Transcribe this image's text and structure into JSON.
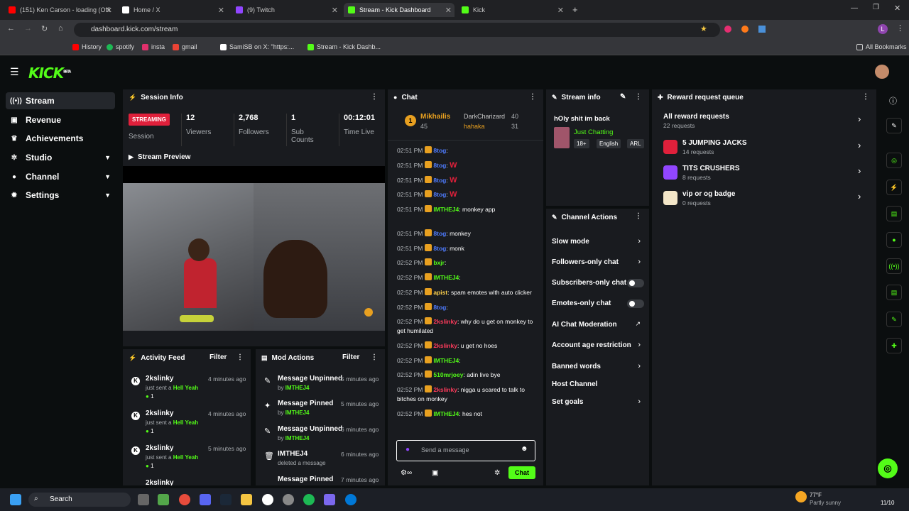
{
  "browser": {
    "tabs": [
      {
        "title": "(151) Ken Carson - loading (Offi",
        "color": "#ff0000"
      },
      {
        "title": "Home / X",
        "color": "#ffffff"
      },
      {
        "title": "(9) Twitch",
        "color": "#9146ff"
      },
      {
        "title": "Stream - Kick Dashboard",
        "color": "#53fc18"
      },
      {
        "title": "Kick",
        "color": "#53fc18"
      }
    ],
    "url": "dashboard.kick.com/stream",
    "bookmarks": [
      "History",
      "spotify",
      "insta",
      "gmail",
      "SamiSB on X: \"https:...",
      "Stream - Kick Dashb..."
    ],
    "all_bookmarks": "All Bookmarks"
  },
  "app": {
    "logo": "KICK",
    "logo_sup": "BETA"
  },
  "sidebar": {
    "items": [
      {
        "label": "Stream",
        "icon": "broadcast-icon"
      },
      {
        "label": "Revenue",
        "icon": "money-icon"
      },
      {
        "label": "Achievements",
        "icon": "trophy-icon"
      },
      {
        "label": "Studio",
        "icon": "gear-icon"
      },
      {
        "label": "Channel",
        "icon": "user-icon"
      },
      {
        "label": "Settings",
        "icon": "settings-icon"
      }
    ]
  },
  "session": {
    "title": "Session Info",
    "status": "STREAMING",
    "session_label": "Session",
    "stats": [
      {
        "value": "12",
        "label": "Viewers"
      },
      {
        "value": "2,768",
        "label": "Followers"
      },
      {
        "value": "1",
        "label": "Sub Counts"
      },
      {
        "value": "00:12:01",
        "label": "Time Live"
      }
    ]
  },
  "preview": {
    "title": "Stream Preview"
  },
  "activity": {
    "title": "Activity Feed",
    "filter": "Filter",
    "items": [
      {
        "user": "2kslinky",
        "action": "just sent a",
        "item": "Hell Yeah",
        "count": "1",
        "time": "4 minutes ago"
      },
      {
        "user": "2kslinky",
        "action": "just sent a",
        "item": "Hell Yeah",
        "count": "1",
        "time": "4 minutes ago"
      },
      {
        "user": "2kslinky",
        "action": "just sent a",
        "item": "Hell Yeah",
        "count": "1",
        "time": "5 minutes ago"
      },
      {
        "user": "2kslinky",
        "action": "",
        "item": "",
        "count": "",
        "time": ""
      }
    ]
  },
  "modactions": {
    "title": "Mod Actions",
    "filter": "Filter",
    "items": [
      {
        "title": "Message Unpinned",
        "by": "by",
        "user": "IMTHEJ4",
        "time": "5 minutes ago"
      },
      {
        "title": "Message Pinned",
        "by": "by",
        "user": "IMTHEJ4",
        "time": "5 minutes ago"
      },
      {
        "title": "Message Unpinned",
        "by": "by",
        "user": "IMTHEJ4",
        "time": "6 minutes ago"
      },
      {
        "title": "IMTHEJ4",
        "by": "deleted a message",
        "user": "",
        "time": "6 minutes ago"
      },
      {
        "title": "Message Pinned",
        "by": "",
        "user": "",
        "time": "7 minutes ago"
      }
    ]
  },
  "chat": {
    "title": "Chat",
    "top": [
      {
        "rank": "1",
        "name": "Mikhailis",
        "count": "45"
      },
      {
        "name": "DarkCharizard",
        "count": "40"
      },
      {
        "name": "hahaka",
        "count": "31"
      }
    ],
    "messages": [
      {
        "time": "02:51 PM",
        "user": "8tog",
        "color": "#4f7cff",
        "text": ""
      },
      {
        "time": "02:51 PM",
        "user": "8tog",
        "color": "#4f7cff",
        "text": "W"
      },
      {
        "time": "02:51 PM",
        "user": "8tog",
        "color": "#4f7cff",
        "text": "W"
      },
      {
        "time": "02:51 PM",
        "user": "8tog",
        "color": "#4f7cff",
        "text": "W"
      },
      {
        "time": "02:51 PM",
        "user": "IMTHEJ4",
        "color": "#53fc18",
        "text": "monkey app"
      },
      {
        "time": "02:51 PM",
        "user": "8tog",
        "color": "#4f7cff",
        "text": "monkey"
      },
      {
        "time": "02:51 PM",
        "user": "8tog",
        "color": "#4f7cff",
        "text": "monk"
      },
      {
        "time": "02:52 PM",
        "user": "bxjr",
        "color": "#53fc18",
        "text": ""
      },
      {
        "time": "02:52 PM",
        "user": "IMTHEJ4",
        "color": "#53fc18",
        "text": ""
      },
      {
        "time": "02:52 PM",
        "user": "apist",
        "color": "#ffd24d",
        "text": "spam emotes with auto clicker"
      },
      {
        "time": "02:52 PM",
        "user": "8tog",
        "color": "#4f7cff",
        "text": ""
      },
      {
        "time": "02:52 PM",
        "user": "2kslinky",
        "color": "#ff3b5c",
        "text": "why do u get on monkey to get humilated"
      },
      {
        "time": "02:52 PM",
        "user": "2kslinky",
        "color": "#ff3b5c",
        "text": "u get no hoes"
      },
      {
        "time": "02:52 PM",
        "user": "IMTHEJ4",
        "color": "#53fc18",
        "text": ""
      },
      {
        "time": "02:52 PM",
        "user": "510mrjoey",
        "color": "#53fc18",
        "text": "adin live bye"
      },
      {
        "time": "02:52 PM",
        "user": "2kslinky",
        "color": "#ff3b5c",
        "text": "nigga u scared to talk to bitches on monkey"
      },
      {
        "time": "02:52 PM",
        "user": "IMTHEJ4",
        "color": "#53fc18",
        "text": "hes not"
      }
    ],
    "placeholder": "Send a message",
    "send": "Chat"
  },
  "streaminfo": {
    "title": "Stream info",
    "stream_title": "hOly shit im back",
    "category": "Just Chatting",
    "tags": [
      "18+",
      "English",
      "ARL"
    ]
  },
  "channelactions": {
    "title": "Channel Actions",
    "items": [
      {
        "label": "Slow mode",
        "type": "arrow"
      },
      {
        "label": "Followers-only chat",
        "type": "arrow"
      },
      {
        "label": "Subscribers-only chat",
        "type": "toggle"
      },
      {
        "label": "Emotes-only chat",
        "type": "toggle"
      },
      {
        "label": "AI Chat Moderation",
        "type": "link"
      },
      {
        "label": "Account age restriction",
        "type": "arrow"
      },
      {
        "label": "Banned words",
        "type": "arrow"
      },
      {
        "label": "Host Channel",
        "type": "none"
      },
      {
        "label": "Set goals",
        "type": "arrow"
      }
    ]
  },
  "rewards": {
    "title": "Reward request queue",
    "all": {
      "label": "All reward requests",
      "count": "22 requests"
    },
    "items": [
      {
        "label": "5 JUMPING JACKS",
        "count": "14 requests",
        "color": "#e0203b"
      },
      {
        "label": "TITS CRUSHERS",
        "count": "8 requests",
        "color": "#9146ff"
      },
      {
        "label": "vip or og badge",
        "count": "0 requests",
        "color": "#f3e6c8"
      }
    ]
  },
  "taskbar": {
    "search": "Search",
    "weather_temp": "77°F",
    "weather_desc": "Partly sunny",
    "date": "11/10"
  }
}
